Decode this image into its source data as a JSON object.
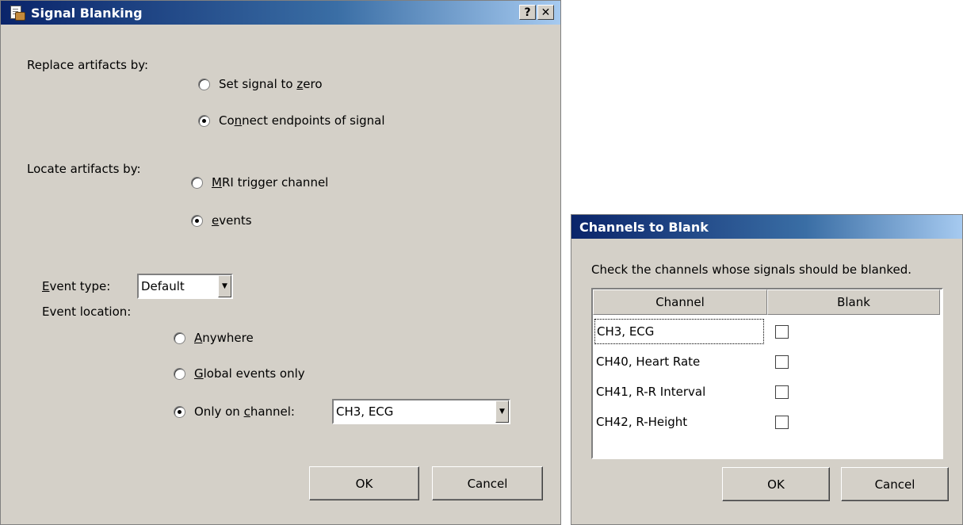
{
  "signal_blanking": {
    "title": "Signal Blanking",
    "help_button": "?",
    "close_button": "✕",
    "replace_label": "Replace artifacts by:",
    "replace_options": [
      {
        "pre": "Set signal to ",
        "acc": "z",
        "post": "ero",
        "selected": false
      },
      {
        "pre": "Co",
        "acc": "n",
        "post": "nect endpoints of signal",
        "selected": true
      }
    ],
    "locate_label": "Locate artifacts by:",
    "locate_options": [
      {
        "pre": "",
        "acc": "M",
        "post": "RI trigger channel",
        "selected": false
      },
      {
        "pre": "",
        "acc": "e",
        "post": "vents",
        "selected": true
      }
    ],
    "event_type_acc": "E",
    "event_type_label": "vent type:",
    "event_type_value": "Default",
    "event_location_label": "Event location:",
    "location_options": [
      {
        "pre": "",
        "acc": "A",
        "post": "nywhere",
        "selected": false
      },
      {
        "pre": "",
        "acc": "G",
        "post": "lobal events only",
        "selected": false
      },
      {
        "pre": "Only on ",
        "acc": "c",
        "post": "hannel:",
        "selected": true
      }
    ],
    "channel_value": "CH3, ECG",
    "ok_label": "OK",
    "cancel_label": "Cancel"
  },
  "channels_to_blank": {
    "title": "Channels to Blank",
    "instruction": "Check the channels whose signals should be blanked.",
    "columns": [
      "Channel",
      "Blank"
    ],
    "rows": [
      {
        "channel": "CH3, ECG",
        "blank": false
      },
      {
        "channel": "CH40, Heart Rate",
        "blank": false
      },
      {
        "channel": "CH41, R-R Interval",
        "blank": false
      },
      {
        "channel": "CH42, R-Height",
        "blank": false
      }
    ],
    "ok_label": "OK",
    "cancel_label": "Cancel"
  },
  "icons": [
    "app-icon",
    "help-icon",
    "close-icon",
    "dropdown-arrow-icon"
  ]
}
